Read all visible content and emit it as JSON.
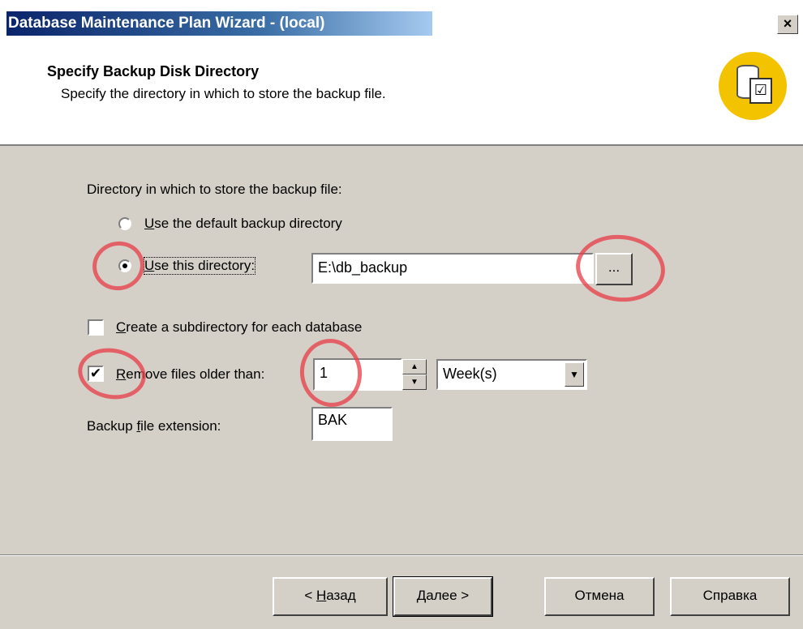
{
  "window": {
    "title": "Database Maintenance Plan Wizard - (local)",
    "close_glyph": "×"
  },
  "header": {
    "title": "Specify Backup Disk Directory",
    "subtitle": "Specify the directory in which to store the backup file.",
    "icon": "database-checklist-icon"
  },
  "directory": {
    "group_label": "Directory in which to store the backup file:",
    "option_default": {
      "prefix": "U",
      "rest": "se the default backup directory",
      "selected": false
    },
    "option_this": {
      "prefix": "U",
      "rest": "se this directory:",
      "selected": true
    },
    "path_value": "E:\\db_backup",
    "browse_label": "..."
  },
  "subdirectory": {
    "prefix": "C",
    "rest": "reate a subdirectory for each database",
    "checked": false
  },
  "remove_older": {
    "prefix": "R",
    "rest": "emove files older than:",
    "checked": true,
    "check_glyph": "✔",
    "amount": "1",
    "unit": "Week(s)"
  },
  "extension": {
    "label_pre": "Backup ",
    "label_u": "f",
    "label_post": "ile extension:",
    "value": "BAK"
  },
  "buttons": {
    "back": {
      "pre": "< ",
      "u": "Н",
      "post": "азад"
    },
    "next": "Далее >",
    "cancel": "Отмена",
    "help": "Справка"
  },
  "colors": {
    "dialog": "#d4d0c8",
    "annotation": "#e83c46",
    "titlebar": "#0a246a",
    "icon_bg": "#f4c300"
  }
}
